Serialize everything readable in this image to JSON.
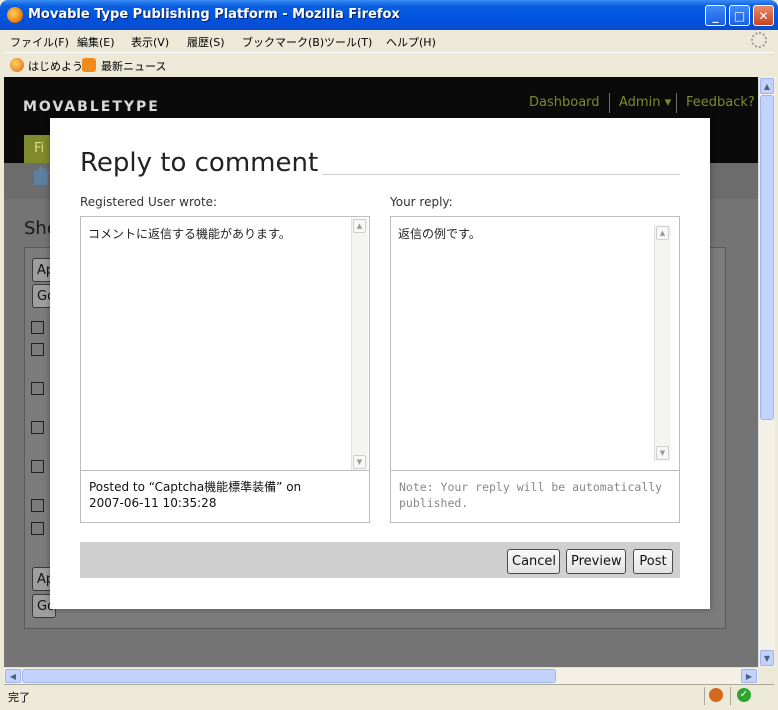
{
  "window": {
    "title": "Movable Type Publishing Platform - Mozilla Firefox",
    "minimize": "_",
    "maximize": "□",
    "close": "✕"
  },
  "menu": [
    "ファイル(F)",
    "編集(E)",
    "表示(V)",
    "履歴(S)",
    "ブックマーク(B)",
    "ツール(T)",
    "ヘルプ(H)"
  ],
  "bookmarks": [
    "はじめよう",
    "最新ニュース"
  ],
  "mt": {
    "logo": "MOVABLETYPE",
    "nav": [
      "Dashboard",
      "Admin ▾",
      "Feedback?"
    ],
    "tab": "Fi",
    "heading": "Sho",
    "bg_buttons": [
      "Ap",
      "Go",
      "Ap",
      "Go"
    ]
  },
  "dialog": {
    "title": "Reply to comment",
    "left_label": "Registered User wrote:",
    "comment_text": "コメントに返信する機能があります。",
    "posted_line1": "Posted to “Captcha機能標準装備” on",
    "posted_line2": "2007-06-11 10:35:28",
    "right_label": "Your reply:",
    "reply_text": "返信の例です。",
    "note": "Note: Your reply will be automatically published.",
    "buttons": {
      "cancel": "Cancel",
      "preview": "Preview",
      "post": "Post"
    }
  },
  "status": {
    "text": "完了"
  },
  "colors": {
    "titlebar": "#0053e1",
    "mt_accent": "#7f8a2a",
    "overlay_bg": "#747474"
  }
}
